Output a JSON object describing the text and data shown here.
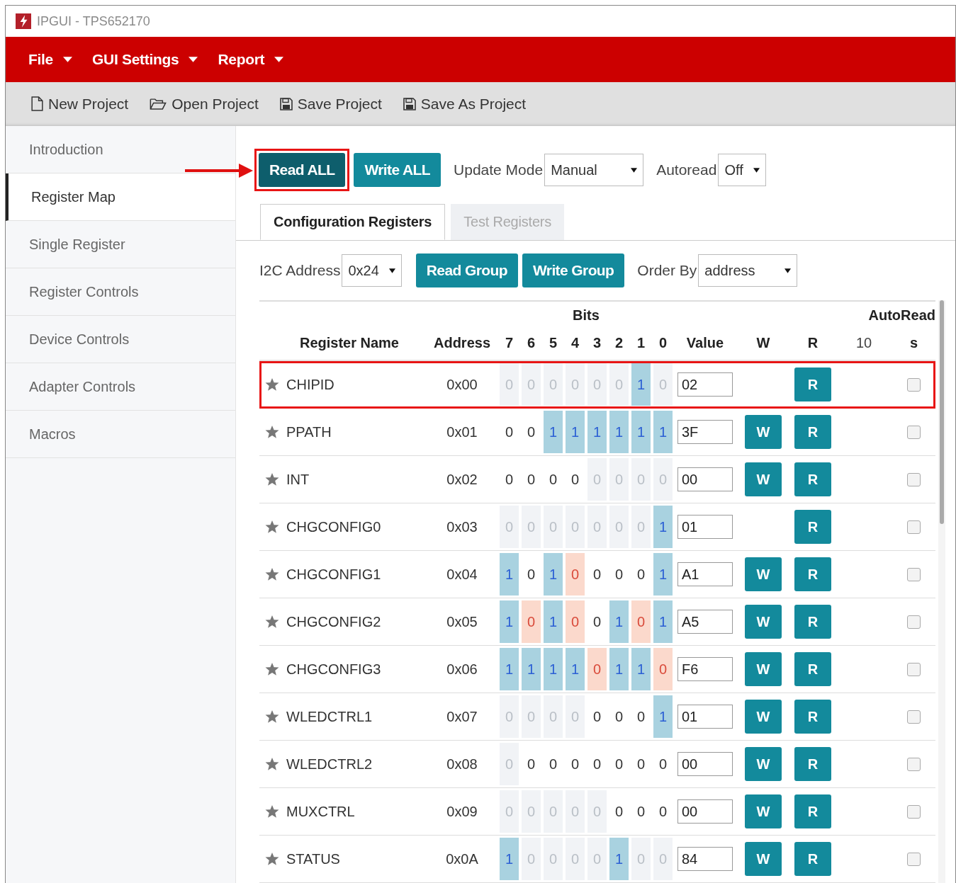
{
  "window": {
    "title": "IPGUI - TPS652170"
  },
  "menu": [
    {
      "label": "File"
    },
    {
      "label": "GUI Settings"
    },
    {
      "label": "Report"
    }
  ],
  "toolbar": [
    {
      "label": "New Project",
      "kind": "new"
    },
    {
      "label": "Open Project",
      "kind": "open"
    },
    {
      "label": "Save Project",
      "kind": "save"
    },
    {
      "label": "Save As Project",
      "kind": "save"
    }
  ],
  "sidebar": {
    "items": [
      {
        "label": "Introduction",
        "selected": false
      },
      {
        "label": "Register Map",
        "selected": true
      },
      {
        "label": "Single Register",
        "selected": false
      },
      {
        "label": "Register Controls",
        "selected": false
      },
      {
        "label": "Device Controls",
        "selected": false
      },
      {
        "label": "Adapter Controls",
        "selected": false
      },
      {
        "label": "Macros",
        "selected": false
      }
    ]
  },
  "actions": {
    "read_all": {
      "label": "Read ALL",
      "highlighted": true
    },
    "write_all": {
      "label": "Write ALL"
    },
    "update_mode": {
      "label": "Update Mode",
      "value": "Manual"
    },
    "autoread": {
      "label": "Autoread",
      "value": "Off"
    }
  },
  "tabs": [
    {
      "label": "Configuration Registers",
      "selected": true
    },
    {
      "label": "Test Registers",
      "selected": false
    }
  ],
  "group_bar": {
    "i2c": {
      "label": "I2C Address",
      "value": "0x24"
    },
    "read_group": "Read Group",
    "write_group": "Write Group",
    "order_by": {
      "label": "Order By",
      "value": "address"
    }
  },
  "table": {
    "headers": {
      "bits_group": "Bits",
      "autoread_group": "AutoRead",
      "name": "Register Name",
      "address": "Address",
      "bits": [
        "7",
        "6",
        "5",
        "4",
        "3",
        "2",
        "1",
        "0"
      ],
      "value": "Value",
      "w": "W",
      "r": "R",
      "interval": "10",
      "unit": "s"
    },
    "rows": [
      {
        "name": "CHIPID",
        "address": "0x00",
        "bits": [
          {
            "v": "0",
            "kind": "readonly"
          },
          {
            "v": "0",
            "kind": "readonly"
          },
          {
            "v": "0",
            "kind": "readonly"
          },
          {
            "v": "0",
            "kind": "readonly"
          },
          {
            "v": "0",
            "kind": "readonly"
          },
          {
            "v": "0",
            "kind": "readonly"
          },
          {
            "v": "1",
            "kind": "high"
          },
          {
            "v": "0",
            "kind": "readonly"
          }
        ],
        "value": "02",
        "read_button": "R",
        "autoread": false,
        "highlighted": true
      },
      {
        "name": "PPATH",
        "address": "0x01",
        "bits": [
          {
            "v": "0",
            "kind": "plain"
          },
          {
            "v": "0",
            "kind": "plain"
          },
          {
            "v": "1",
            "kind": "high"
          },
          {
            "v": "1",
            "kind": "high"
          },
          {
            "v": "1",
            "kind": "high"
          },
          {
            "v": "1",
            "kind": "high"
          },
          {
            "v": "1",
            "kind": "high"
          },
          {
            "v": "1",
            "kind": "high"
          }
        ],
        "value": "3F",
        "write_button": "W",
        "read_button": "R",
        "autoread": false,
        "highlighted": false
      },
      {
        "name": "INT",
        "address": "0x02",
        "bits": [
          {
            "v": "0",
            "kind": "plain"
          },
          {
            "v": "0",
            "kind": "plain"
          },
          {
            "v": "0",
            "kind": "plain"
          },
          {
            "v": "0",
            "kind": "plain"
          },
          {
            "v": "0",
            "kind": "readonly"
          },
          {
            "v": "0",
            "kind": "readonly"
          },
          {
            "v": "0",
            "kind": "readonly"
          },
          {
            "v": "0",
            "kind": "readonly"
          }
        ],
        "value": "00",
        "write_button": "W",
        "read_button": "R",
        "autoread": false,
        "highlighted": false
      },
      {
        "name": "CHGCONFIG0",
        "address": "0x03",
        "bits": [
          {
            "v": "0",
            "kind": "readonly"
          },
          {
            "v": "0",
            "kind": "readonly"
          },
          {
            "v": "0",
            "kind": "readonly"
          },
          {
            "v": "0",
            "kind": "readonly"
          },
          {
            "v": "0",
            "kind": "readonly"
          },
          {
            "v": "0",
            "kind": "readonly"
          },
          {
            "v": "0",
            "kind": "readonly"
          },
          {
            "v": "1",
            "kind": "high"
          }
        ],
        "value": "01",
        "read_button": "R",
        "autoread": false,
        "highlighted": false
      },
      {
        "name": "CHGCONFIG1",
        "address": "0x04",
        "bits": [
          {
            "v": "1",
            "kind": "high"
          },
          {
            "v": "0",
            "kind": "plain"
          },
          {
            "v": "1",
            "kind": "high"
          },
          {
            "v": "0",
            "kind": "low"
          },
          {
            "v": "0",
            "kind": "plain"
          },
          {
            "v": "0",
            "kind": "plain"
          },
          {
            "v": "0",
            "kind": "plain"
          },
          {
            "v": "1",
            "kind": "high"
          }
        ],
        "value": "A1",
        "write_button": "W",
        "read_button": "R",
        "autoread": false,
        "highlighted": false
      },
      {
        "name": "CHGCONFIG2",
        "address": "0x05",
        "bits": [
          {
            "v": "1",
            "kind": "high"
          },
          {
            "v": "0",
            "kind": "low"
          },
          {
            "v": "1",
            "kind": "high"
          },
          {
            "v": "0",
            "kind": "low"
          },
          {
            "v": "0",
            "kind": "plain"
          },
          {
            "v": "1",
            "kind": "high"
          },
          {
            "v": "0",
            "kind": "low"
          },
          {
            "v": "1",
            "kind": "high"
          }
        ],
        "value": "A5",
        "write_button": "W",
        "read_button": "R",
        "autoread": false,
        "highlighted": false
      },
      {
        "name": "CHGCONFIG3",
        "address": "0x06",
        "bits": [
          {
            "v": "1",
            "kind": "high"
          },
          {
            "v": "1",
            "kind": "high"
          },
          {
            "v": "1",
            "kind": "high"
          },
          {
            "v": "1",
            "kind": "high"
          },
          {
            "v": "0",
            "kind": "low"
          },
          {
            "v": "1",
            "kind": "high"
          },
          {
            "v": "1",
            "kind": "high"
          },
          {
            "v": "0",
            "kind": "low"
          }
        ],
        "value": "F6",
        "write_button": "W",
        "read_button": "R",
        "autoread": false,
        "highlighted": false
      },
      {
        "name": "WLEDCTRL1",
        "address": "0x07",
        "bits": [
          {
            "v": "0",
            "kind": "readonly"
          },
          {
            "v": "0",
            "kind": "readonly"
          },
          {
            "v": "0",
            "kind": "readonly"
          },
          {
            "v": "0",
            "kind": "readonly"
          },
          {
            "v": "0",
            "kind": "plain"
          },
          {
            "v": "0",
            "kind": "plain"
          },
          {
            "v": "0",
            "kind": "plain"
          },
          {
            "v": "1",
            "kind": "high"
          }
        ],
        "value": "01",
        "write_button": "W",
        "read_button": "R",
        "autoread": false,
        "highlighted": false
      },
      {
        "name": "WLEDCTRL2",
        "address": "0x08",
        "bits": [
          {
            "v": "0",
            "kind": "readonly"
          },
          {
            "v": "0",
            "kind": "plain"
          },
          {
            "v": "0",
            "kind": "plain"
          },
          {
            "v": "0",
            "kind": "plain"
          },
          {
            "v": "0",
            "kind": "plain"
          },
          {
            "v": "0",
            "kind": "plain"
          },
          {
            "v": "0",
            "kind": "plain"
          },
          {
            "v": "0",
            "kind": "plain"
          }
        ],
        "value": "00",
        "write_button": "W",
        "read_button": "R",
        "autoread": false,
        "highlighted": false
      },
      {
        "name": "MUXCTRL",
        "address": "0x09",
        "bits": [
          {
            "v": "0",
            "kind": "readonly"
          },
          {
            "v": "0",
            "kind": "readonly"
          },
          {
            "v": "0",
            "kind": "readonly"
          },
          {
            "v": "0",
            "kind": "readonly"
          },
          {
            "v": "0",
            "kind": "readonly"
          },
          {
            "v": "0",
            "kind": "plain"
          },
          {
            "v": "0",
            "kind": "plain"
          },
          {
            "v": "0",
            "kind": "plain"
          }
        ],
        "value": "00",
        "write_button": "W",
        "read_button": "R",
        "autoread": false,
        "highlighted": false
      },
      {
        "name": "STATUS",
        "address": "0x0A",
        "bits": [
          {
            "v": "1",
            "kind": "high"
          },
          {
            "v": "0",
            "kind": "readonly"
          },
          {
            "v": "0",
            "kind": "readonly"
          },
          {
            "v": "0",
            "kind": "readonly"
          },
          {
            "v": "0",
            "kind": "readonly"
          },
          {
            "v": "1",
            "kind": "high"
          },
          {
            "v": "0",
            "kind": "readonly"
          },
          {
            "v": "0",
            "kind": "readonly"
          }
        ],
        "value": "84",
        "write_button": "W",
        "read_button": "R",
        "autoread": false,
        "highlighted": false
      }
    ]
  }
}
